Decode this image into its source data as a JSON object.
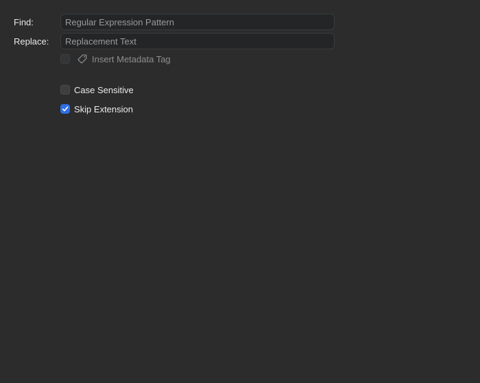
{
  "find": {
    "label": "Find:",
    "value": "",
    "placeholder": "Regular Expression Pattern"
  },
  "replace": {
    "label": "Replace:",
    "value": "",
    "placeholder": "Replacement Text"
  },
  "options": {
    "insert_metadata_tag": {
      "label": "Insert Metadata Tag",
      "checked": false,
      "enabled": false,
      "icon": "tag-icon"
    },
    "case_sensitive": {
      "label": "Case Sensitive",
      "checked": false
    },
    "skip_extension": {
      "label": "Skip Extension",
      "checked": true
    }
  },
  "colors": {
    "background": "#2c2c2c",
    "accent": "#2f6fe6"
  }
}
